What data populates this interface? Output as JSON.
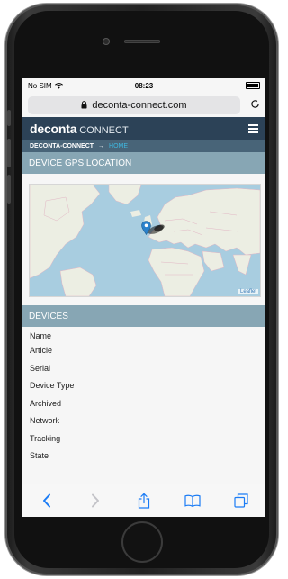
{
  "status_bar": {
    "carrier": "No SIM",
    "time": "08:23"
  },
  "browser": {
    "url": "deconta-connect.com"
  },
  "site": {
    "brand_bold": "deconta",
    "brand_light": "CONNECT",
    "breadcrumb": {
      "root": "DECONTA-CONNECT",
      "arrow": "→",
      "current": "HOME"
    }
  },
  "gps_section": {
    "title": "DEVICE GPS LOCATION",
    "attribution": "Leaflet"
  },
  "devices_section": {
    "title": "DEVICES",
    "fields": [
      "Name",
      "Article",
      "Serial",
      "Device Type",
      "Archived",
      "Network",
      "Tracking",
      "State"
    ]
  },
  "icons": {
    "wifi": "wifi-icon",
    "lock": "lock-icon",
    "reload": "reload-icon",
    "menu": "hamburger-menu-icon",
    "map_marker": "map-marker-icon",
    "back": "back-chevron-icon",
    "forward": "forward-chevron-icon",
    "share": "share-icon",
    "bookmarks": "bookmarks-icon",
    "tabs": "tabs-icon"
  },
  "colors": {
    "header_bg": "#2c4257",
    "breadcrumb_bg": "#486478",
    "breadcrumb_home": "#3fb8e0",
    "section_bg": "#87a6b4",
    "safari_blue": "#1b7cf5",
    "map_water": "#a8cde0",
    "map_land": "#eceee3"
  }
}
